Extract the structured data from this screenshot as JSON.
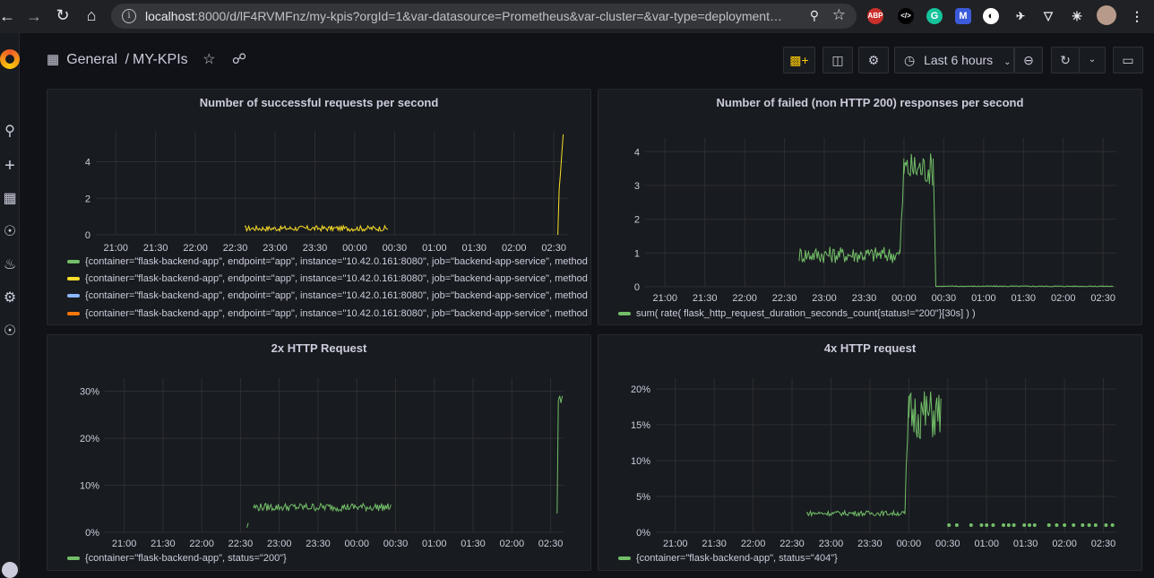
{
  "browser": {
    "url_host": "localhost",
    "url_rest": ":8000/d/lF4RVMFnz/my-kpis?orgId=1&var-datasource=Prometheus&var-cluster=&var-type=deployment…",
    "extensions": [
      "ABP",
      "</>",
      "G",
      "M",
      "◐",
      "✈",
      "▽",
      "✳"
    ]
  },
  "dashboard": {
    "folder": "General",
    "separator": "/",
    "title": "MY-KPIs",
    "time_range": "Last 6 hours"
  },
  "colors": {
    "green": "#73bf69",
    "yellow": "#fade2a",
    "blue": "#8ab8ff",
    "orange": "#ff780a",
    "grid": "#2c2e33"
  },
  "panels": {
    "p1": {
      "title": "Number of successful requests per second",
      "legend": [
        {
          "label": "{container=\"flask-backend-app\", endpoint=\"app\", instance=\"10.42.0.161:8080\", job=\"backend-app-service\", method",
          "color": "#73bf69"
        },
        {
          "label": "{container=\"flask-backend-app\", endpoint=\"app\", instance=\"10.42.0.161:8080\", job=\"backend-app-service\", method",
          "color": "#fade2a"
        },
        {
          "label": "{container=\"flask-backend-app\", endpoint=\"app\", instance=\"10.42.0.161:8080\", job=\"backend-app-service\", method",
          "color": "#8ab8ff"
        },
        {
          "label": "{container=\"flask-backend-app\", endpoint=\"app\", instance=\"10.42.0.161:8080\", job=\"backend-app-service\", method",
          "color": "#ff780a"
        }
      ]
    },
    "p2": {
      "title": "Number of failed (non HTTP 200) responses per second",
      "legend": [
        {
          "label": "sum( rate( flask_http_request_duration_seconds_count{status!=\"200\"}[30s] ) )",
          "color": "#73bf69"
        }
      ]
    },
    "p3": {
      "title": "2x HTTP Request",
      "legend": [
        {
          "label": "{container=\"flask-backend-app\", status=\"200\"}",
          "color": "#73bf69"
        }
      ]
    },
    "p4": {
      "title": "4x HTTP request",
      "legend": [
        {
          "label": "{container=\"flask-backend-app\", status=\"404\"}",
          "color": "#73bf69"
        }
      ]
    }
  },
  "chart_data": [
    {
      "type": "line",
      "title": "Number of successful requests per second",
      "x_ticks": [
        "21:00",
        "21:30",
        "22:00",
        "22:30",
        "23:00",
        "23:30",
        "00:00",
        "00:30",
        "01:00",
        "01:30",
        "02:00",
        "02:30"
      ],
      "y_ticks": [
        "0",
        "2",
        "4"
      ],
      "ylim": [
        0,
        5.5
      ],
      "series": [
        {
          "color": "#fade2a",
          "segments": [
            {
              "x": [
                "22:37",
                "00:25"
              ],
              "band": [
                0.2,
                0.5
              ]
            },
            {
              "points": [
                [
                  "02:33",
                  0
                ],
                [
                  "02:34",
                  2.5
                ],
                [
                  "02:35",
                  3.4
                ],
                [
                  "02:36",
                  4.5
                ],
                [
                  "02:37",
                  5.5
                ]
              ]
            }
          ]
        }
      ]
    },
    {
      "type": "line",
      "title": "Number of failed (non HTTP 200) responses per second",
      "x_ticks": [
        "21:00",
        "21:30",
        "22:00",
        "22:30",
        "23:00",
        "23:30",
        "00:00",
        "00:30",
        "01:00",
        "01:30",
        "02:00",
        "02:30"
      ],
      "y_ticks": [
        "0",
        "1",
        "2",
        "3",
        "4"
      ],
      "ylim": [
        0,
        4.3
      ],
      "series": [
        {
          "color": "#73bf69",
          "segments": [
            {
              "x": [
                "22:41",
                "23:57"
              ],
              "band": [
                0.7,
                1.2
              ]
            },
            {
              "points": [
                [
                  "23:57",
                  1
                ],
                [
                  "23:58",
                  2
                ],
                [
                  "23:59",
                  2.5
                ],
                [
                  "24:00",
                  3.8
                ]
              ]
            },
            {
              "x": [
                "24:00",
                "00:22"
              ],
              "band": [
                3.0,
                4.0
              ]
            },
            {
              "points": [
                [
                  "00:22",
                  3.8
                ],
                [
                  "00:23",
                  2.0
                ],
                [
                  "00:24",
                  0
                ]
              ]
            },
            {
              "x": [
                "00:24",
                "02:38"
              ],
              "band": [
                0,
                0.03
              ]
            }
          ]
        }
      ]
    },
    {
      "type": "line",
      "title": "2x HTTP Request",
      "x_ticks": [
        "21:00",
        "21:30",
        "22:00",
        "22:30",
        "23:00",
        "23:30",
        "00:00",
        "00:30",
        "01:00",
        "01:30",
        "02:00",
        "02:30"
      ],
      "y_ticks": [
        "0%",
        "10%",
        "20%",
        "30%"
      ],
      "ylim": [
        0,
        32
      ],
      "series": [
        {
          "color": "#73bf69",
          "segments": [
            {
              "points": [
                [
                  "22:35",
                  1
                ],
                [
                  "22:36",
                  2
                ]
              ]
            },
            {
              "x": [
                "22:40",
                "00:27"
              ],
              "band": [
                4.5,
                6.2
              ]
            },
            {
              "points": [
                [
                  "02:35",
                  4
                ],
                [
                  "02:36",
                  28
                ],
                [
                  "02:37",
                  29
                ],
                [
                  "02:38",
                  27.5
                ],
                [
                  "02:39",
                  29
                ]
              ]
            }
          ]
        }
      ]
    },
    {
      "type": "line",
      "title": "4x HTTP request",
      "x_ticks": [
        "21:00",
        "21:30",
        "22:00",
        "22:30",
        "23:00",
        "23:30",
        "00:00",
        "00:30",
        "01:00",
        "01:30",
        "02:00",
        "02:30"
      ],
      "y_ticks": [
        "0%",
        "5%",
        "10%",
        "15%",
        "20%"
      ],
      "ylim": [
        0,
        21
      ],
      "series": [
        {
          "color": "#73bf69",
          "segments": [
            {
              "x": [
                "22:41",
                "23:57"
              ],
              "band": [
                2.3,
                3.0
              ]
            },
            {
              "points": [
                [
                  "23:57",
                  2.5
                ],
                [
                  "23:58",
                  9
                ],
                [
                  "23:59",
                  13
                ],
                [
                  "24:00",
                  19
                ]
              ]
            },
            {
              "x": [
                "24:00",
                "00:25"
              ],
              "band": [
                13,
                20
              ]
            },
            {
              "dots": [
                "00:31",
                "00:37",
                "00:48",
                "00:56",
                "01:00",
                "01:05",
                "01:13",
                "01:17",
                "01:21",
                "01:29",
                "01:33",
                "01:37",
                "01:48",
                "01:54",
                "02:00",
                "02:07",
                "02:14",
                "02:19",
                "02:24",
                "02:32",
                "02:37"
              ],
              "value": 1
            }
          ]
        }
      ]
    }
  ]
}
